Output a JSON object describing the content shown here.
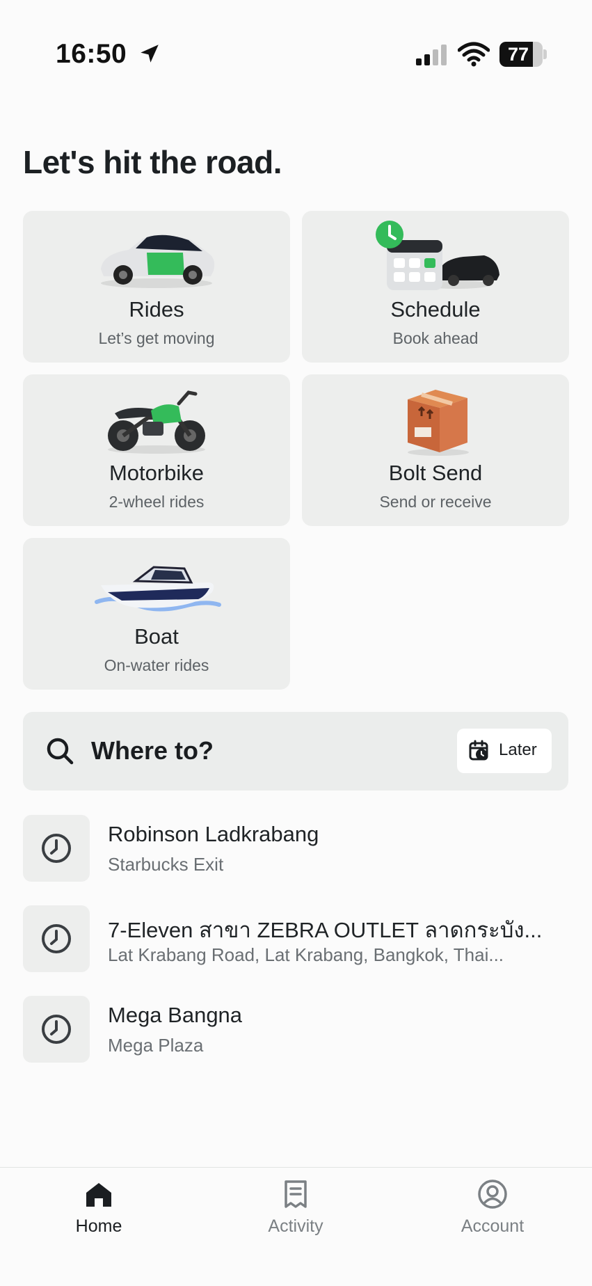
{
  "status_bar": {
    "time": "16:50",
    "battery_level": "77",
    "battery_fraction": 0.77
  },
  "headline": "Let's hit the road.",
  "services": [
    {
      "id": "rides",
      "title": "Rides",
      "subtitle": "Let’s get moving",
      "icon": "car-icon"
    },
    {
      "id": "schedule",
      "title": "Schedule",
      "subtitle": "Book ahead",
      "icon": "calendar-car-icon"
    },
    {
      "id": "motorbike",
      "title": "Motorbike",
      "subtitle": "2-wheel rides",
      "icon": "motorbike-icon"
    },
    {
      "id": "send",
      "title": "Bolt Send",
      "subtitle": "Send or receive",
      "icon": "package-icon"
    },
    {
      "id": "boat",
      "title": "Boat",
      "subtitle": "On-water rides",
      "icon": "boat-icon"
    }
  ],
  "search": {
    "label": "Where to?",
    "later_label": "Later"
  },
  "recent": [
    {
      "title": "Robinson Ladkrabang",
      "subtitle": "Starbucks Exit"
    },
    {
      "title": "7-Eleven สาขา ZEBRA OUTLET ลาดกระบัง...",
      "subtitle": "Lat Krabang Road, Lat Krabang, Bangkok, Thai..."
    },
    {
      "title": "Mega Bangna",
      "subtitle": "Mega Plaza"
    }
  ],
  "nav": [
    {
      "label": "Home",
      "icon": "home-icon",
      "active": true
    },
    {
      "label": "Activity",
      "icon": "receipt-icon",
      "active": false
    },
    {
      "label": "Account",
      "icon": "account-icon",
      "active": false
    }
  ],
  "colors": {
    "brand_green": "#34bb5a",
    "tile_bg": "#edeeed",
    "text_primary": "#1f2326",
    "text_secondary": "#5d6266"
  }
}
